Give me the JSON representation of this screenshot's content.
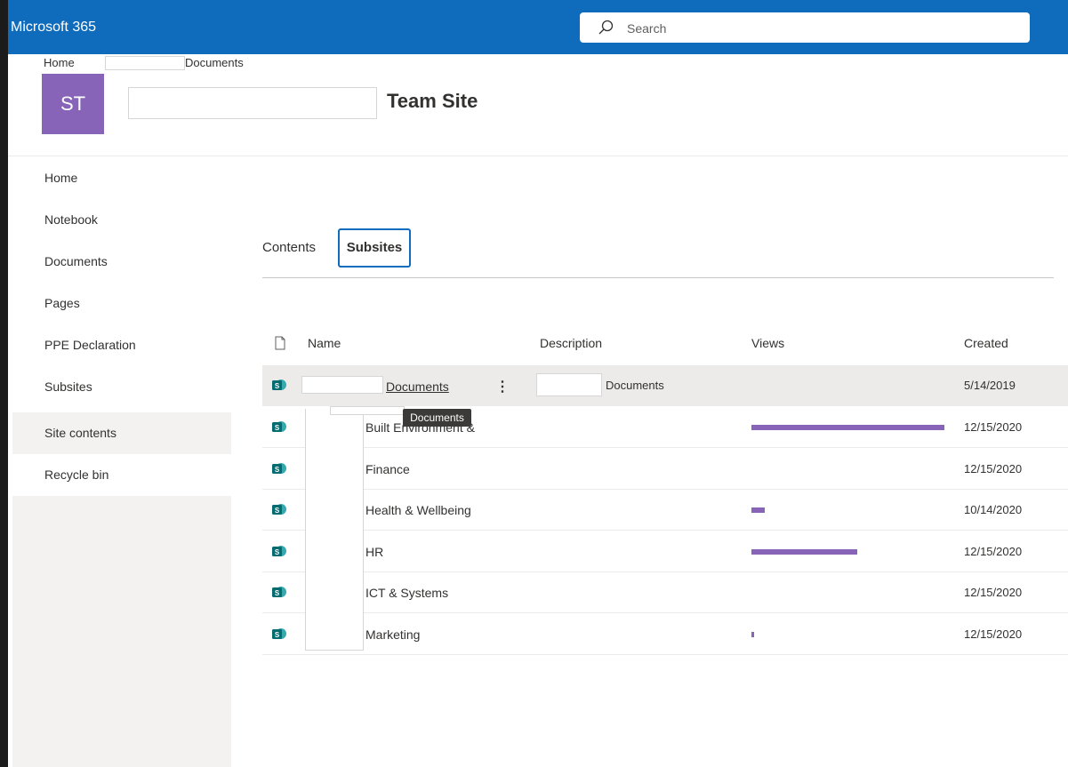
{
  "suitebar": {
    "brand": "Microsoft 365",
    "search_placeholder": "Search"
  },
  "breadcrumb": {
    "home": "Home",
    "current": "Documents"
  },
  "site": {
    "logo_initials": "ST",
    "title": "Team Site",
    "logo_color": "#8764b8"
  },
  "nav": {
    "items": [
      {
        "label": "Home"
      },
      {
        "label": "Notebook"
      },
      {
        "label": "Documents"
      },
      {
        "label": "Pages"
      },
      {
        "label": "PPE Declaration"
      },
      {
        "label": "Subsites"
      },
      {
        "label": "Site contents",
        "selected": true
      },
      {
        "label": "Recycle bin"
      }
    ]
  },
  "tabs": {
    "contents": "Contents",
    "subsites": "Subsites"
  },
  "table": {
    "headers": {
      "name": "Name",
      "description": "Description",
      "views": "Views",
      "created": "Created"
    },
    "rows": [
      {
        "name": "Documents",
        "description": "Documents",
        "created": "5/14/2019",
        "views_fraction": 0
      },
      {
        "name": "Built Environment &",
        "description": "",
        "created": "12/15/2020",
        "views_fraction": 1.0
      },
      {
        "name": "Finance",
        "description": "",
        "created": "12/15/2020",
        "views_fraction": 0
      },
      {
        "name": "Health & Wellbeing",
        "description": "",
        "created": "10/14/2020",
        "views_fraction": 0.07
      },
      {
        "name": "HR",
        "description": "",
        "created": "12/15/2020",
        "views_fraction": 0.55
      },
      {
        "name": "ICT & Systems",
        "description": "",
        "created": "12/15/2020",
        "views_fraction": 0
      },
      {
        "name": "Marketing",
        "description": "",
        "created": "12/15/2020",
        "views_fraction": 0.01
      }
    ]
  },
  "tooltip": "Documents",
  "colors": {
    "suitebar": "#0f6cbd",
    "accent": "#8764b8",
    "sharepoint_icon": "#036c70"
  }
}
